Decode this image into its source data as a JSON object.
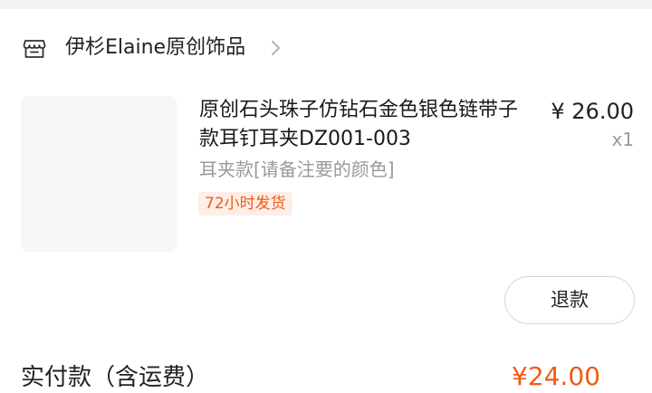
{
  "shop": {
    "name": "伊杉Elaine原创饰品"
  },
  "item": {
    "title": "原创石头珠子仿钻石金色银色链带子款耳钉耳夹DZ001-003",
    "variant": "耳夹款[请备注要的颜色]",
    "tag": "72小时发货",
    "price": "¥ 26.00",
    "quantity": "x1"
  },
  "actions": {
    "refund_label": "退款"
  },
  "summary": {
    "label": "实付款（含运费）",
    "amount": "¥24.00"
  },
  "colors": {
    "accent": "#f05a16",
    "tag_bg": "#fdeee7",
    "muted_text": "#9a9a9a"
  }
}
